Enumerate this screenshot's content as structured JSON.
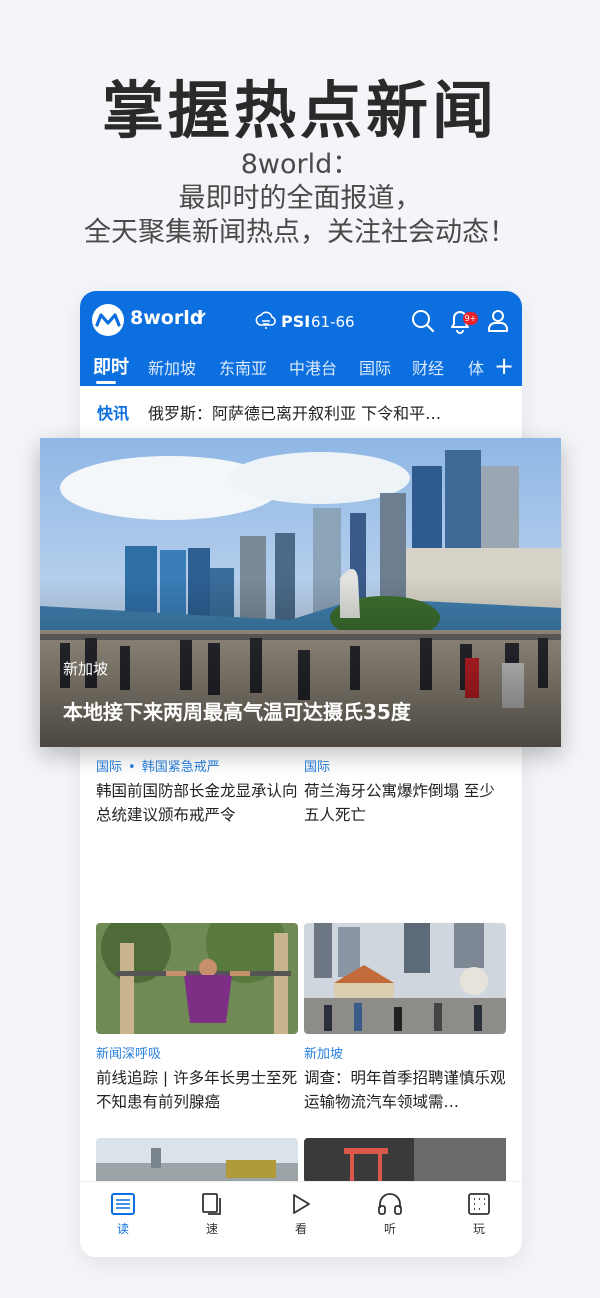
{
  "hero": {
    "title": "掌握热点新闻",
    "line1": "8world：",
    "line2": "最即时的全面报道，",
    "line3": "全天聚集新闻热点，关注社会动态！"
  },
  "app": {
    "logo_text": "8world",
    "psi_label": "PSI",
    "psi_value": "61-66",
    "notification_badge": "9+",
    "accent_color": "#0c6fe0"
  },
  "tabs": [
    "即时",
    "新加坡",
    "东南亚",
    "中港台",
    "国际",
    "财经",
    "体"
  ],
  "flash": {
    "tag": "快讯",
    "text": "俄罗斯：阿萨德已离开叙利亚 下令和平…"
  },
  "feature": {
    "category": "新加坡",
    "title": "本地接下来两周最高气温可达摄氏35度"
  },
  "articles": [
    {
      "category": "国际",
      "subcategory": "韩国紧急戒严",
      "headline": "韩国前国防部长金龙显承认向总统建议颁布戒严令"
    },
    {
      "category": "国际",
      "subcategory": "",
      "headline": "荷兰海牙公寓爆炸倒塌 至少五人死亡"
    },
    {
      "category": "新闻深呼吸",
      "subcategory": "",
      "headline": "前线追踪 | 许多年长男士至死不知患有前列腺癌"
    },
    {
      "category": "新加坡",
      "subcategory": "",
      "headline": "调查：明年首季招聘谨慎乐观 运输物流汽车领域需…"
    }
  ],
  "bottom_nav": [
    {
      "label": "读",
      "icon": "read-icon"
    },
    {
      "label": "速",
      "icon": "quick-icon"
    },
    {
      "label": "看",
      "icon": "play-icon"
    },
    {
      "label": "听",
      "icon": "headphones-icon"
    },
    {
      "label": "玩",
      "icon": "games-icon"
    }
  ]
}
